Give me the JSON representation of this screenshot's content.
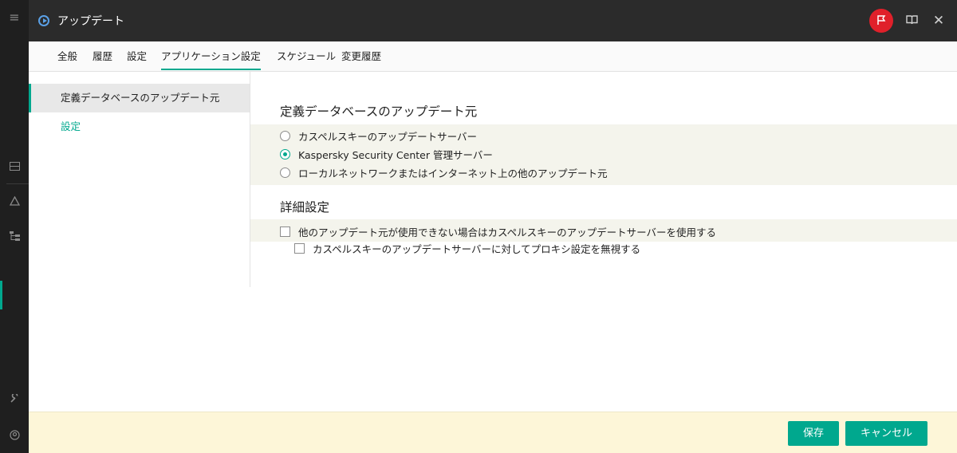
{
  "window": {
    "title": "アップデート"
  },
  "tabs": [
    {
      "label": "全般"
    },
    {
      "label": "履歴"
    },
    {
      "label": "設定"
    },
    {
      "label": "アプリケーション設定"
    },
    {
      "label": "スケジュール"
    },
    {
      "label": "変更履歴"
    }
  ],
  "active_tab": "アプリケーション設定",
  "sidebar": {
    "items": [
      {
        "label": "定義データベースのアップデート元",
        "selected": true
      },
      {
        "label": "設定",
        "selected": false
      }
    ]
  },
  "sources_section": {
    "title": "定義データベースのアップデート元",
    "options": [
      {
        "label": "カスペルスキーのアップデートサーバー",
        "selected": false
      },
      {
        "label": "Kaspersky Security Center 管理サーバー",
        "selected": true
      },
      {
        "label": "ローカルネットワークまたはインターネット上の他のアップデート元",
        "selected": false
      }
    ]
  },
  "advanced_section": {
    "title": "詳細設定",
    "checkboxes": [
      {
        "label": "他のアップデート元が使用できない場合はカスペルスキーのアップデートサーバーを使用する",
        "checked": false
      },
      {
        "label": "カスペルスキーのアップデートサーバーに対してプロキシ設定を無視する",
        "checked": false
      }
    ]
  },
  "footer": {
    "save_label": "保存",
    "cancel_label": "キャンセル"
  },
  "colors": {
    "accent": "#00a88e",
    "flag_button": "#e0202a",
    "titlebar": "#2b2b2b",
    "footer": "#fdf6d8"
  },
  "icons": {
    "rail": [
      "menu-icon",
      "list-icon",
      "warning-icon",
      "tree-icon",
      "wrench-icon",
      "account-icon"
    ]
  }
}
